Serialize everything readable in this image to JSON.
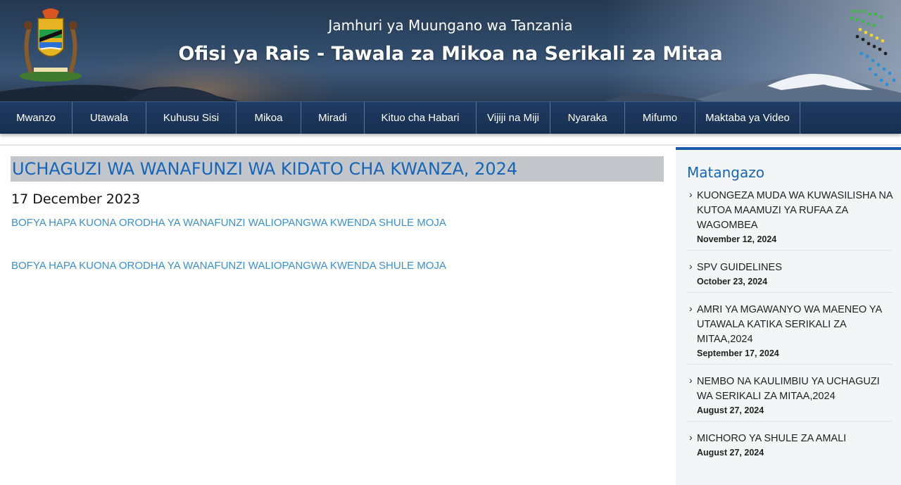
{
  "header": {
    "subtitle": "Jamhuri ya Muungano wa Tanzania",
    "title": "Ofisi ya Rais - Tawala za Mikoa na Serikali za Mitaa"
  },
  "nav": {
    "items": [
      {
        "label": "Mwanzo"
      },
      {
        "label": "Utawala"
      },
      {
        "label": "Kuhusu Sisi"
      },
      {
        "label": "Mikoa"
      },
      {
        "label": "Miradi"
      },
      {
        "label": "Kituo cha Habari"
      },
      {
        "label": "Vijiji na Miji"
      },
      {
        "label": "Nyaraka"
      },
      {
        "label": "Mifumo"
      },
      {
        "label": "Maktaba ya Video"
      }
    ]
  },
  "main": {
    "title": "UCHAGUZI WA WANAFUNZI WA KIDATO CHA KWANZA, 2024",
    "date": "17 December 2023",
    "links": [
      "BOFYA HAPA KUONA ORODHA YA WANAFUNZI WALIOPANGWA KWENDA SHULE MOJA",
      "BOFYA HAPA KUONA ORODHA YA WANAFUNZI WALIOPANGWA KWENDA SHULE MOJA"
    ]
  },
  "sidebar": {
    "title": "Matangazo",
    "items": [
      {
        "title": "KUONGEZA MUDA WA KUWASILISHA NA KUTOA MAAMUZI YA RUFAA ZA WAGOMBEA",
        "date": "November 12, 2024"
      },
      {
        "title": "SPV GUIDELINES",
        "date": "October 23, 2024"
      },
      {
        "title": "AMRI YA MGAWANYO WA MAENEO YA UTAWALA KATIKA SERIKALI ZA MITAA,2024",
        "date": "September 17, 2024"
      },
      {
        "title": "NEMBO NA KAULIMBIU YA UCHAGUZI WA SERIKALI ZA MITAA,2024",
        "date": "August 27, 2024"
      },
      {
        "title": "MICHORO YA SHULE ZA AMALI",
        "date": "August 27, 2024"
      }
    ]
  },
  "icons": {
    "logo": "coat-of-arms-icon",
    "map": "tanzania-map-icon",
    "bullet": "chevron-right-icon"
  },
  "colors": {
    "nav_bg": "#1f3a64",
    "title_blue": "#1565b8",
    "link_blue": "#3a8fd0",
    "title_bar": "#c3c7cc",
    "sidebar_accent": "#1b5aa8"
  }
}
